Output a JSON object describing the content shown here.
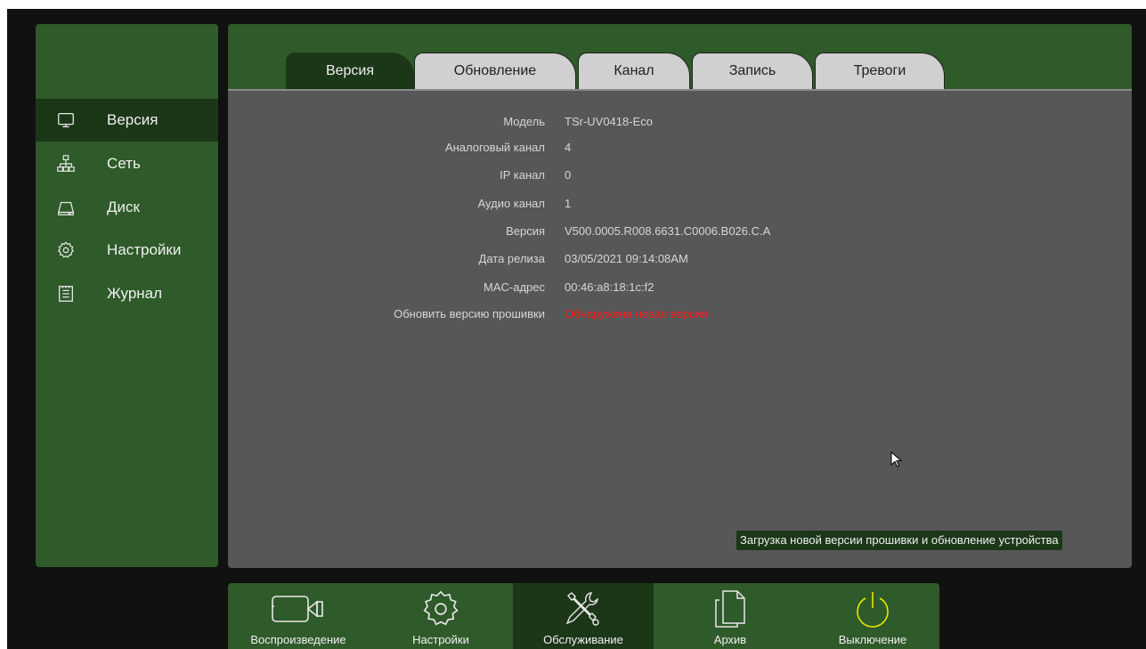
{
  "sidebar": {
    "items": [
      {
        "label": "Версия",
        "icon": "monitor-icon",
        "active": true
      },
      {
        "label": "Сеть",
        "icon": "network-icon",
        "active": false
      },
      {
        "label": "Диск",
        "icon": "disk-icon",
        "active": false
      },
      {
        "label": "Настройки",
        "icon": "gear-icon",
        "active": false
      },
      {
        "label": "Журнал",
        "icon": "log-icon",
        "active": false
      }
    ]
  },
  "tabs": [
    {
      "label": "Версия",
      "active": true
    },
    {
      "label": "Обновление",
      "active": false
    },
    {
      "label": "Канал",
      "active": false
    },
    {
      "label": "Запись",
      "active": false
    },
    {
      "label": "Тревоги",
      "active": false
    }
  ],
  "info": {
    "rows": [
      {
        "label": "Модель",
        "value": "TSr-UV0418-Eco"
      },
      {
        "label": "Аналоговый канал",
        "value": "4"
      },
      {
        "label": "IP канал",
        "value": "0"
      },
      {
        "label": "Аудио канал",
        "value": "1"
      },
      {
        "label": "Версия",
        "value": "V500.0005.R008.6631.C0006.B026.C.A"
      },
      {
        "label": "Дата релиза",
        "value": "03/05/2021 09:14:08AM"
      },
      {
        "label": "MAC-адрес",
        "value": "00:46:a8:18:1c:f2"
      },
      {
        "label": "Обновить версию прошивки",
        "value": "Обнаружена новая версия"
      }
    ]
  },
  "tooltip": "Загрузка новой версии прошивки и обновление устройства",
  "dock": {
    "items": [
      {
        "label": "Воспроизведение",
        "icon": "camera-icon",
        "active": false
      },
      {
        "label": "Настройки",
        "icon": "gear-icon",
        "active": false
      },
      {
        "label": "Обслуживание",
        "icon": "tools-icon",
        "active": true
      },
      {
        "label": "Архив",
        "icon": "files-icon",
        "active": false
      },
      {
        "label": "Выключение",
        "icon": "power-icon",
        "active": false
      }
    ]
  },
  "colors": {
    "panel_green": "#2f5a2a",
    "active_green": "#1b3718",
    "content_gray": "#575757",
    "alert_red": "#ff1a1a",
    "power_yellow": "#e6e600"
  }
}
